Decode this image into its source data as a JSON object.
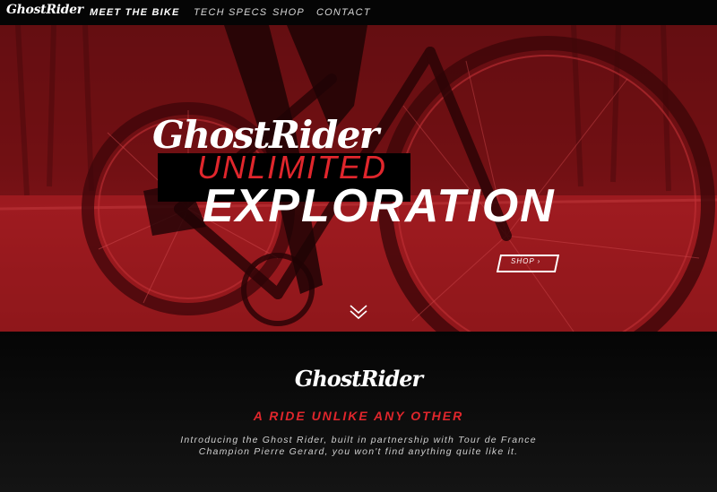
{
  "nav": {
    "logo": "GhostRider",
    "links": [
      {
        "label": "MEET THE BIKE",
        "active": true
      },
      {
        "label": "TECH SPECS",
        "active": false
      },
      {
        "label": "SHOP",
        "active": false
      },
      {
        "label": "CONTACT",
        "active": false
      }
    ]
  },
  "hero": {
    "logo": "GhostRider",
    "line1": "UNLIMITED",
    "line2": "EXPLORATION",
    "shop_button": "SHOP",
    "shop_arrow_icon": "chevron-right-icon",
    "scroll_icon": "double-chevron-down-icon"
  },
  "intro": {
    "logo": "GhostRider",
    "heading": "A RIDE UNLIKE ANY OTHER",
    "text_line1": "Introducing the Ghost Rider, built in partnership with Tour de France",
    "text_line2": "Champion Pierre Gerard, you won't find anything quite like it."
  },
  "colors": {
    "accent": "#e0262c",
    "hero_tint": "#8a1418",
    "nav_bg": "#050505",
    "text": "#ffffff"
  }
}
